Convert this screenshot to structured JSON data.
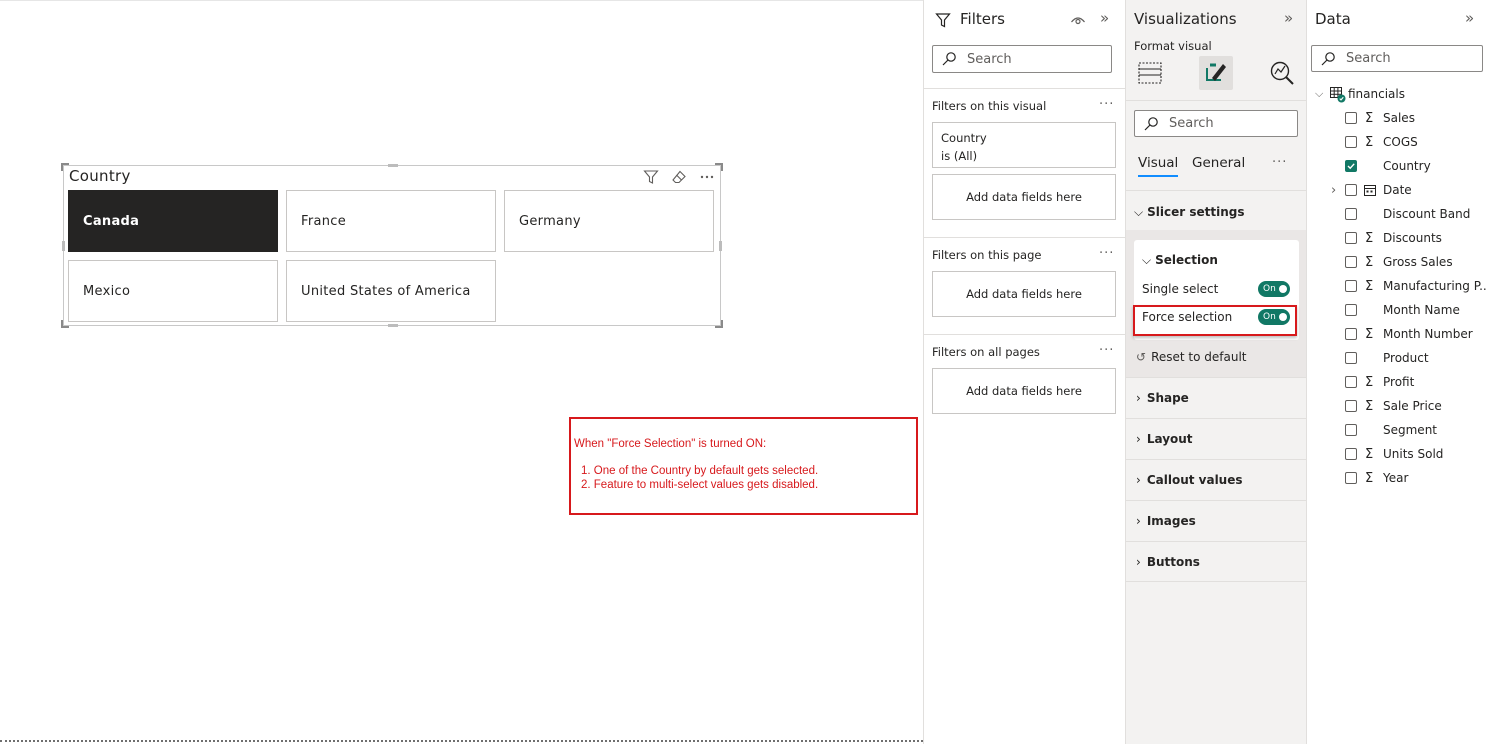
{
  "canvas": {
    "slicer": {
      "title": "Country",
      "tiles": [
        "Canada",
        "France",
        "Germany",
        "Mexico",
        "United States of America"
      ],
      "selected": "Canada"
    },
    "note": {
      "heading": "When \"Force Selection\" is turned ON:",
      "items": [
        "1. One of the Country by default gets selected.",
        "2. Feature to multi-select values gets disabled."
      ]
    }
  },
  "filters": {
    "title": "Filters",
    "search_placeholder": "Search",
    "on_visual": "Filters on this visual",
    "visual_filter": {
      "field": "Country",
      "state": "is (All)"
    },
    "add_fields": "Add data fields here",
    "on_page": "Filters on this page",
    "on_all_pages": "Filters on all pages"
  },
  "visualizations": {
    "title": "Visualizations",
    "subtitle": "Format visual",
    "search_placeholder": "Search",
    "tabs": [
      "Visual",
      "General"
    ],
    "active_tab": "Visual",
    "slicer_settings": "Slicer settings",
    "selection": {
      "label": "Selection",
      "single_select": "Single select",
      "single_select_state": "On",
      "force_selection": "Force selection",
      "force_selection_state": "On"
    },
    "reset": "Reset to default",
    "sections": [
      "Shape",
      "Layout",
      "Callout values",
      "Images",
      "Buttons"
    ]
  },
  "data": {
    "title": "Data",
    "search_placeholder": "Search",
    "table": "financials",
    "fields": [
      {
        "name": "Sales",
        "sigma": true,
        "checked": false
      },
      {
        "name": "COGS",
        "sigma": true,
        "checked": false
      },
      {
        "name": "Country",
        "sigma": false,
        "checked": true
      },
      {
        "name": "Date",
        "sigma": false,
        "checked": false,
        "calendar": true,
        "expandable": true
      },
      {
        "name": "Discount Band",
        "sigma": false,
        "checked": false
      },
      {
        "name": "Discounts",
        "sigma": true,
        "checked": false
      },
      {
        "name": "Gross Sales",
        "sigma": true,
        "checked": false
      },
      {
        "name": "Manufacturing P...",
        "sigma": true,
        "checked": false
      },
      {
        "name": "Month Name",
        "sigma": false,
        "checked": false
      },
      {
        "name": "Month Number",
        "sigma": true,
        "checked": false
      },
      {
        "name": "Product",
        "sigma": false,
        "checked": false
      },
      {
        "name": "Profit",
        "sigma": true,
        "checked": false
      },
      {
        "name": "Sale Price",
        "sigma": true,
        "checked": false
      },
      {
        "name": "Segment",
        "sigma": false,
        "checked": false
      },
      {
        "name": "Units Sold",
        "sigma": true,
        "checked": false
      },
      {
        "name": "Year",
        "sigma": true,
        "checked": false
      }
    ]
  },
  "colors": {
    "accent": "#117865",
    "highlight": "#d7191c",
    "selected_tile": "#252423",
    "tab_underline": "#118dff"
  }
}
